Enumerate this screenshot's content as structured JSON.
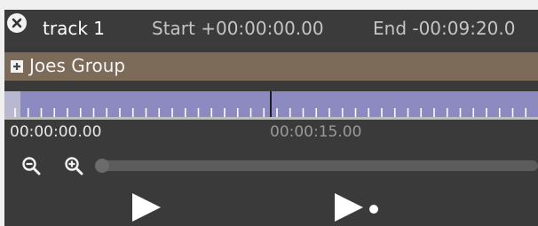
{
  "header": {
    "track_name": "track 1",
    "start_label": "Start +00:00:00.00",
    "end_label": "End -00:09:20.0"
  },
  "group": {
    "name": "Joes Group",
    "expand_icon": "plus-icon"
  },
  "timeline": {
    "start_time": "00:00:00.00",
    "mid_time": "00:00:15.00"
  },
  "zoom": {
    "zoom_out_icon": "zoom-out-icon",
    "zoom_in_icon": "zoom-in-icon",
    "level": 0
  },
  "transport": {
    "play_icon": "play-icon",
    "play_selection_icon": "play-to-point-icon"
  },
  "colors": {
    "panel_bg": "#3a3a3a",
    "group_bar": "#7b6b58",
    "ruler": "#8d8ac1"
  }
}
